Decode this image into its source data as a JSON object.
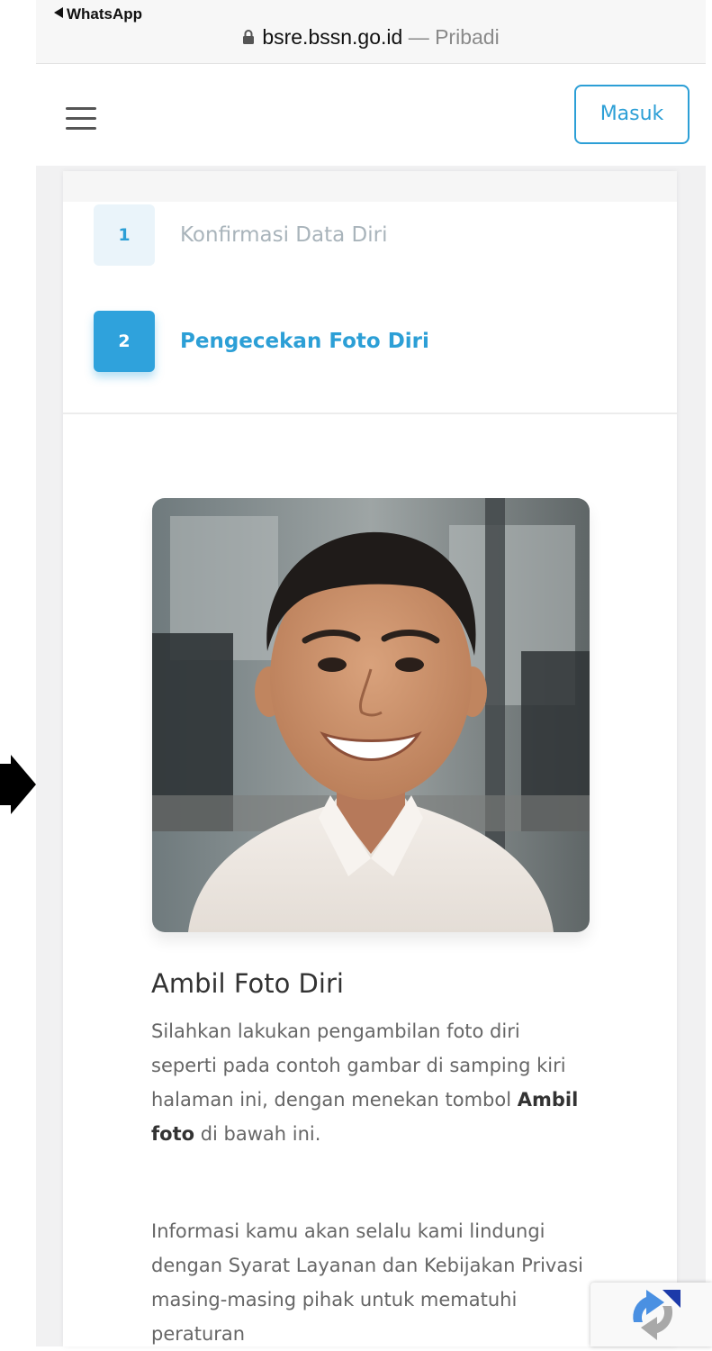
{
  "status_bar": {
    "back_app": "WhatsApp",
    "domain": "bsre.bssn.go.id",
    "separator": "—",
    "mode": "Pribadi"
  },
  "header": {
    "login_label": "Masuk",
    "menu_icon": "hamburger-icon"
  },
  "steps": [
    {
      "number": "1",
      "label": "Konfirmasi Data Diri",
      "state": "done"
    },
    {
      "number": "2",
      "label": "Pengecekan Foto Diri",
      "state": "active"
    }
  ],
  "main": {
    "title": "Ambil Foto Diri",
    "desc_part1": "Silahkan lakukan pengambilan foto diri seperti pada contoh gambar di samping kiri halaman ini, dengan menekan tombol",
    "desc_bold": "Ambil foto",
    "desc_part2": "di bawah ini.",
    "info": "Informasi kamu akan selalu kami lindungi dengan Syarat Layanan dan Kebijakan Privasi masing-masing pihak untuk mematuhi peraturan"
  },
  "colors": {
    "accent": "#2c9fd6",
    "step_active_bg": "#2fa2dc",
    "step_done_bg": "#eaf4fa",
    "text_muted": "#666666"
  }
}
